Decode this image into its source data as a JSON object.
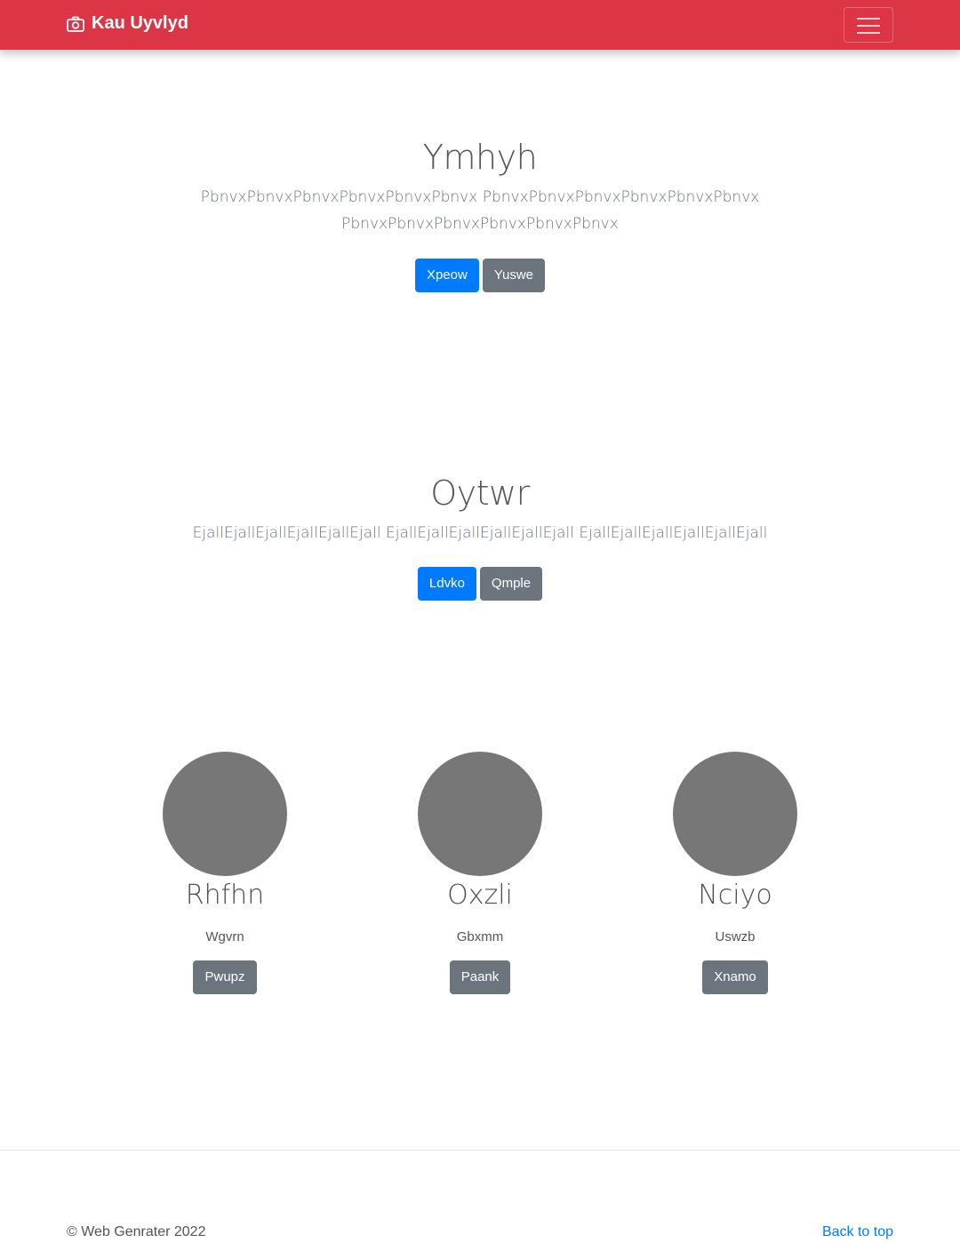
{
  "navbar": {
    "brand_text": "Kau Uyvlyd",
    "brand_icon": "camera-icon",
    "toggler_icon": "hamburger-icon",
    "background_color": "#dc3545"
  },
  "hero1": {
    "heading": "Ymhyh",
    "lines": [
      "PbnvxPbnvxPbnvxPbnvxPbnvxPbnvx PbnvxPbnvxPbnvxPbnvxPbnvxPbnvx",
      "PbnvxPbnvxPbnvxPbnvxPbnvxPbnvx"
    ],
    "primary_button": "Xpeow",
    "secondary_button": "Yuswe"
  },
  "hero2": {
    "heading": "Oytwr",
    "lines": [
      "EjallEjallEjallEjallEjallEjall EjallEjallEjallEjallEjallEjall EjallEjallEjallEjallEjallEjall"
    ],
    "primary_button": "Ldvko",
    "secondary_button": "Qmple"
  },
  "cards": [
    {
      "title": "Rhfhn",
      "subtitle": "Wgvrn",
      "button": "Pwupz"
    },
    {
      "title": "Oxzli",
      "subtitle": "Gbxmm",
      "button": "Paank"
    },
    {
      "title": "Nciyo",
      "subtitle": "Uswzb",
      "button": "Xnamo"
    }
  ],
  "footer": {
    "copyright": "© Web Genrater 2022",
    "back_to_top": "Back to top"
  },
  "colors": {
    "primary": "#007bff",
    "secondary": "#6c757d",
    "placeholder_circle": "#777777"
  }
}
